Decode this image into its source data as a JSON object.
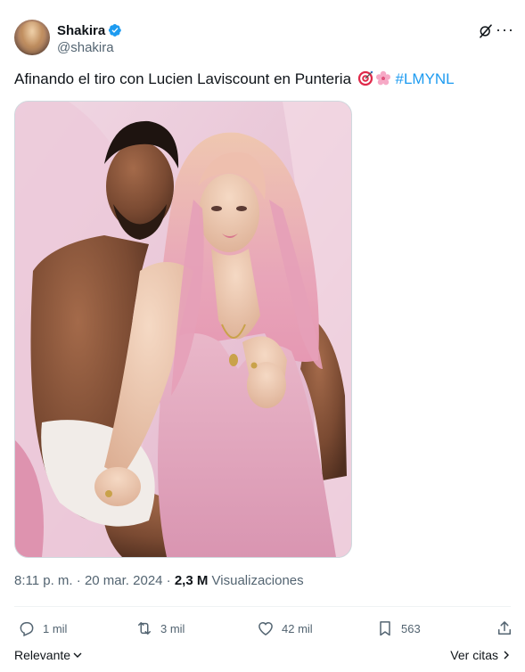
{
  "author": {
    "display_name": "Shakira",
    "handle": "@shakira",
    "verified": true,
    "verified_color": "#1d9bf0"
  },
  "tweet": {
    "text_main": "Afinando el tiro con Lucien Laviscount en Punteria",
    "emojis": [
      "target-emoji",
      "cherry-blossom-emoji"
    ],
    "hashtag": "#LMYNL",
    "hashtag_color": "#1d9bf0"
  },
  "media": {
    "icon": "photo"
  },
  "meta": {
    "time": "8:11 p. m.",
    "separator": "·",
    "date": "20 mar. 2024",
    "views_count": "2,3 M",
    "views_label": "Visualizaciones"
  },
  "actions": {
    "reply_count": "1 mil",
    "retweet_count": "3 mil",
    "like_count": "42 mil",
    "bookmark_count": "563"
  },
  "bottom": {
    "sort_label": "Relevante",
    "quotes_label": "Ver citas"
  },
  "icons": {
    "reply": "reply-icon",
    "retweet": "retweet-icon",
    "like": "heart-icon",
    "bookmark": "bookmark-icon",
    "share": "share-icon",
    "grok": "grok-icon",
    "more": "more-icon"
  }
}
